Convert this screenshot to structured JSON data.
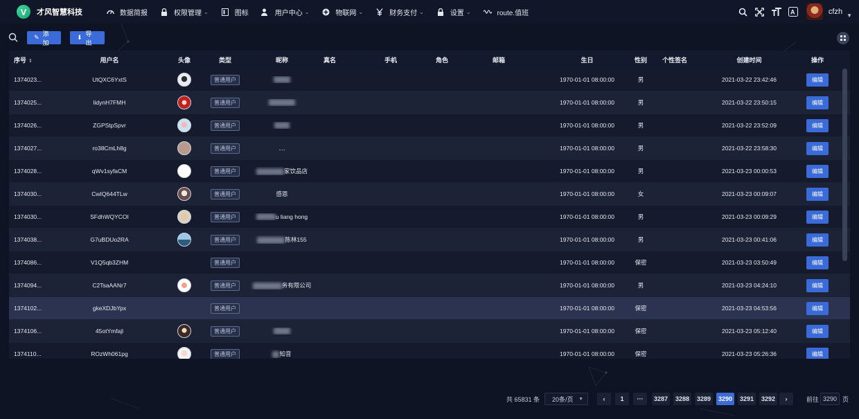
{
  "header": {
    "logo_letter": "V",
    "app_title": "才风智慧科技",
    "menu": [
      {
        "label": "数据简报",
        "icon": "dashboard-icon",
        "has_caret": false
      },
      {
        "label": "权限管理",
        "icon": "lock-icon",
        "has_caret": true
      },
      {
        "label": "图标",
        "icon": "image-icon",
        "has_caret": false
      },
      {
        "label": "用户中心",
        "icon": "user-icon",
        "has_caret": true
      },
      {
        "label": "物联网",
        "icon": "plus-circle-icon",
        "has_caret": true
      },
      {
        "label": "财务支付",
        "icon": "yen-icon",
        "has_caret": true
      },
      {
        "label": "设置",
        "icon": "lock-icon",
        "has_caret": true
      },
      {
        "label": "route.值班",
        "icon": "wave-icon",
        "has_caret": false
      }
    ],
    "user_name": "cfzh"
  },
  "toolbar": {
    "add_label": "添加",
    "export_label": "导出"
  },
  "table": {
    "columns": [
      "序号",
      "用户名",
      "头像",
      "类型",
      "昵称",
      "真名",
      "手机",
      "角色",
      "邮箱",
      "生日",
      "性别",
      "个性签名",
      "创建时间",
      "操作"
    ],
    "rows": [
      {
        "id": "1374023...",
        "username": "UtQXC6YxtS",
        "avatar": "av0",
        "type": "普通用户",
        "nick": "",
        "nick_blur": 24,
        "birthday": "1970-01-01 08:00:00",
        "gender": "男",
        "created": "2021-03-22 23:42:46",
        "op": "编辑"
      },
      {
        "id": "1374025...",
        "username": "lidynH7FMH",
        "avatar": "av1",
        "type": "普通用户",
        "nick": "",
        "nick_blur": 38,
        "birthday": "1970-01-01 08:00:00",
        "gender": "男",
        "created": "2021-03-22 23:50:15",
        "op": "编辑"
      },
      {
        "id": "1374026...",
        "username": "ZGPStpSpvr",
        "avatar": "av2",
        "type": "普通用户",
        "nick": "",
        "nick_blur": 22,
        "birthday": "1970-01-01 08:00:00",
        "gender": "男",
        "created": "2021-03-22 23:52:09",
        "op": "编辑"
      },
      {
        "id": "1374027...",
        "username": "ro38CmLh8g",
        "avatar": "av3",
        "type": "普通用户",
        "nick": "....",
        "nick_blur": 0,
        "birthday": "1970-01-01 08:00:00",
        "gender": "男",
        "created": "2021-03-22 23:58:30",
        "op": "编辑"
      },
      {
        "id": "1374028...",
        "username": "qWv1syfaCM",
        "avatar": "av4",
        "type": "普通用户",
        "nick": "家饮品店",
        "nick_blur": 40,
        "birthday": "1970-01-01 08:00:00",
        "gender": "男",
        "created": "2021-03-23 00:00:53",
        "op": "编辑"
      },
      {
        "id": "1374030...",
        "username": "CwIQ644TLw",
        "avatar": "av5",
        "type": "普通用户",
        "nick": "感恩",
        "nick_blur": 0,
        "birthday": "1970-01-01 08:00:00",
        "gender": "女",
        "created": "2021-03-23 00:09:07",
        "op": "编辑"
      },
      {
        "id": "1374030...",
        "username": "SFdhWQYCOI",
        "avatar": "av6",
        "type": "普通用户",
        "nick": "u liang hong",
        "nick_blur": 28,
        "birthday": "1970-01-01 08:00:00",
        "gender": "男",
        "created": "2021-03-23 00:09:29",
        "op": "编辑"
      },
      {
        "id": "1374038...",
        "username": "G7uBDUo2RA",
        "avatar": "av7",
        "type": "普通用户",
        "nick": "陈林155",
        "nick_blur": 40,
        "birthday": "1970-01-01 08:00:00",
        "gender": "男",
        "created": "2021-03-23 00:41:06",
        "op": "编辑"
      },
      {
        "id": "1374086...",
        "username": "V1Q5qb3ZHM",
        "avatar": "",
        "type": "普通用户",
        "nick": "",
        "nick_blur": 0,
        "birthday": "1970-01-01 08:00:00",
        "gender": "保密",
        "created": "2021-03-23 03:50:49",
        "op": "编辑"
      },
      {
        "id": "1374094...",
        "username": "C2TsaAANr7",
        "avatar": "av9",
        "type": "普通用户",
        "nick": "务有限公司",
        "nick_blur": 42,
        "birthday": "1970-01-01 08:00:00",
        "gender": "男",
        "created": "2021-03-23 04:24:10",
        "op": "编辑"
      },
      {
        "id": "1374102...",
        "username": "gkeXDJbYpx",
        "avatar": "",
        "type": "普通用户",
        "nick": "",
        "nick_blur": 0,
        "birthday": "1970-01-01 08:00:00",
        "gender": "保密",
        "created": "2021-03-23 04:53:56",
        "op": "编辑"
      },
      {
        "id": "1374106...",
        "username": "45otYmfajl",
        "avatar": "av11",
        "type": "普通用户",
        "nick": "",
        "nick_blur": 24,
        "birthday": "1970-01-01 08:00:00",
        "gender": "保密",
        "created": "2021-03-23 05:12:40",
        "op": "编辑"
      },
      {
        "id": "1374110...",
        "username": "ROzWh061pg",
        "avatar": "av12",
        "type": "普通用户",
        "nick": "知音",
        "nick_blur": 10,
        "birthday": "1970-01-01 08:00:00",
        "gender": "保密",
        "created": "2021-03-23 05:26:36",
        "op": "编辑"
      }
    ],
    "highlight_row": 10
  },
  "pagination": {
    "total": "共 65831 条",
    "page_size": "20条/页",
    "pages": [
      "1",
      "···",
      "3287",
      "3288",
      "3289",
      "3290",
      "3291",
      "3292"
    ],
    "active_page": "3290",
    "goto_label": "前往",
    "goto_value": "3290",
    "goto_unit": "页"
  },
  "colors": {
    "background": "#0f1424",
    "accent": "#3a6bd8",
    "logo": "#1aa874"
  }
}
